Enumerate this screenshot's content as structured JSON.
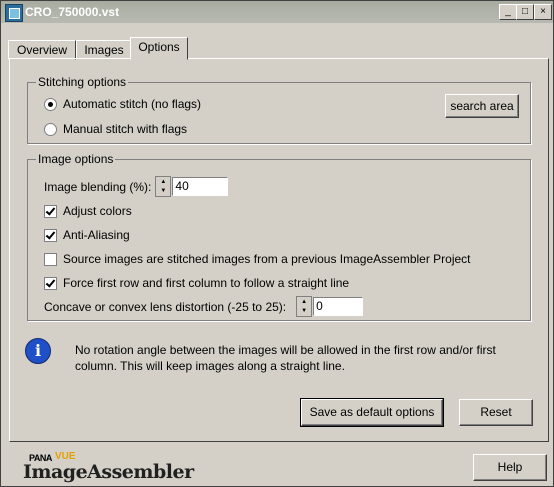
{
  "window": {
    "title": "CRO_750000.vst",
    "minimize_label": "_",
    "maximize_label": "□",
    "close_label": "×"
  },
  "tabs": [
    "Overview",
    "Images",
    "Options"
  ],
  "stitching": {
    "group_title": "Stitching options",
    "auto_label": "Automatic stitch (no flags)",
    "manual_label": "Manual stitch with flags",
    "search_button": "search area"
  },
  "image_options": {
    "group_title": "Image options",
    "blending_label": "Image blending (%):",
    "blending_value": "40",
    "adjust_colors": "Adjust colors",
    "anti_aliasing": "Anti-Aliasing",
    "source_images": "Source images are stitched images from a previous ImageAssembler Project",
    "force_first_row": "Force first row and first column to follow a straight line",
    "distortion_label": "Concave or convex lens distortion (-25 to 25):",
    "distortion_value": "0"
  },
  "info": {
    "text": "No rotation angle between the images will be allowed in the first row and/or first column. This will keep images along a straight line."
  },
  "buttons": {
    "save_default": "Save as default options",
    "reset": "Reset",
    "help": "Help"
  },
  "logo": {
    "small": "PANA",
    "badge": "VUE",
    "main": "ImageAssembler"
  }
}
